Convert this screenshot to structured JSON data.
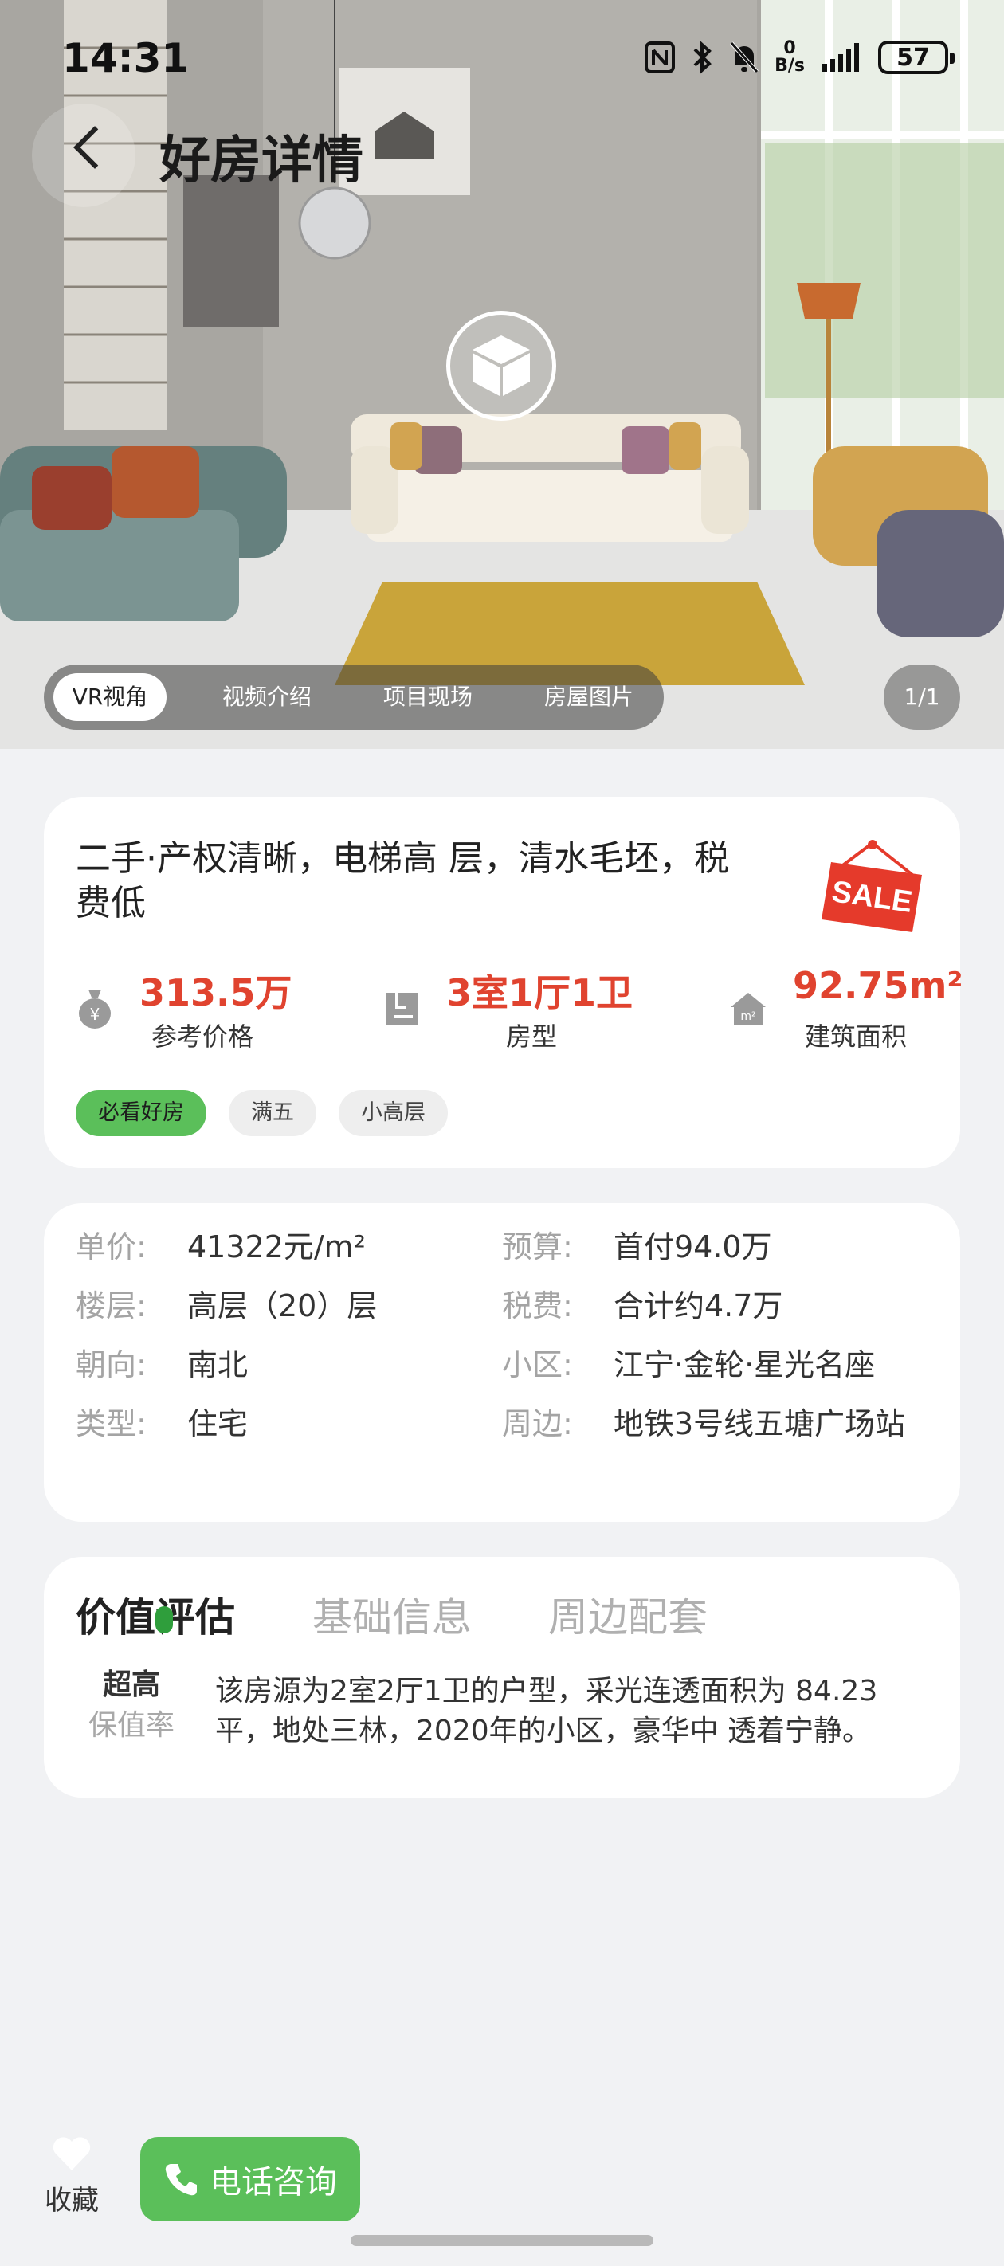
{
  "status_bar": {
    "time": "14:31",
    "net_speed_top": "0",
    "net_speed_bottom": "B/s",
    "battery": "57"
  },
  "header": {
    "title": "好房详情"
  },
  "media": {
    "tabs": [
      {
        "label": "VR视角",
        "active": true
      },
      {
        "label": "视频介绍",
        "active": false
      },
      {
        "label": "项目现场",
        "active": false
      },
      {
        "label": "房屋图片",
        "active": false
      }
    ],
    "pager": "1/1"
  },
  "summary": {
    "headline": "二手·产权清晰，电梯高 层，清水毛坯，税费低",
    "sale_badge": "SALE",
    "stats": [
      {
        "icon": "money-bag-icon",
        "value": "313.5万",
        "label": "参考价格"
      },
      {
        "icon": "floorplan-icon",
        "value": "3室1厅1卫",
        "label": "房型"
      },
      {
        "icon": "house-area-icon",
        "value": "92.75m²",
        "label": "建筑面积"
      }
    ],
    "tags": [
      {
        "label": "必看好房",
        "highlight": true
      },
      {
        "label": "满五",
        "highlight": false
      },
      {
        "label": "小高层",
        "highlight": false
      }
    ]
  },
  "details": {
    "left": [
      {
        "key": "单价:",
        "value": "41322元/m²"
      },
      {
        "key": "楼层:",
        "value": "高层（20）层"
      },
      {
        "key": "朝向:",
        "value": "南北"
      },
      {
        "key": "类型:",
        "value": "住宅"
      }
    ],
    "right": [
      {
        "key": "预算:",
        "value": "首付94.0万"
      },
      {
        "key": "税费:",
        "value": "合计约4.7万"
      },
      {
        "key": "小区:",
        "value": "江宁·金轮·星光名座"
      },
      {
        "key": "周边:",
        "value": "地铁3号线五塘广场站"
      }
    ]
  },
  "evaluation": {
    "tabs": [
      {
        "label": "价值评估",
        "active": true
      },
      {
        "label": "基础信息",
        "active": false
      },
      {
        "label": "周边配套",
        "active": false
      }
    ],
    "rate_top": "超高",
    "rate_bottom": "保值率",
    "description": "该房源为2室2厅1卫的户型，采光连透面积为 84.23 平，地处三林，2020年的小区，豪华中 透着宁静。"
  },
  "bottom_bar": {
    "favorite_label": "收藏",
    "call_label": "电话咨询"
  },
  "colors": {
    "accent_green": "#5bbf5a",
    "price_red": "#e0432f",
    "sale_red": "#e53a2b"
  }
}
